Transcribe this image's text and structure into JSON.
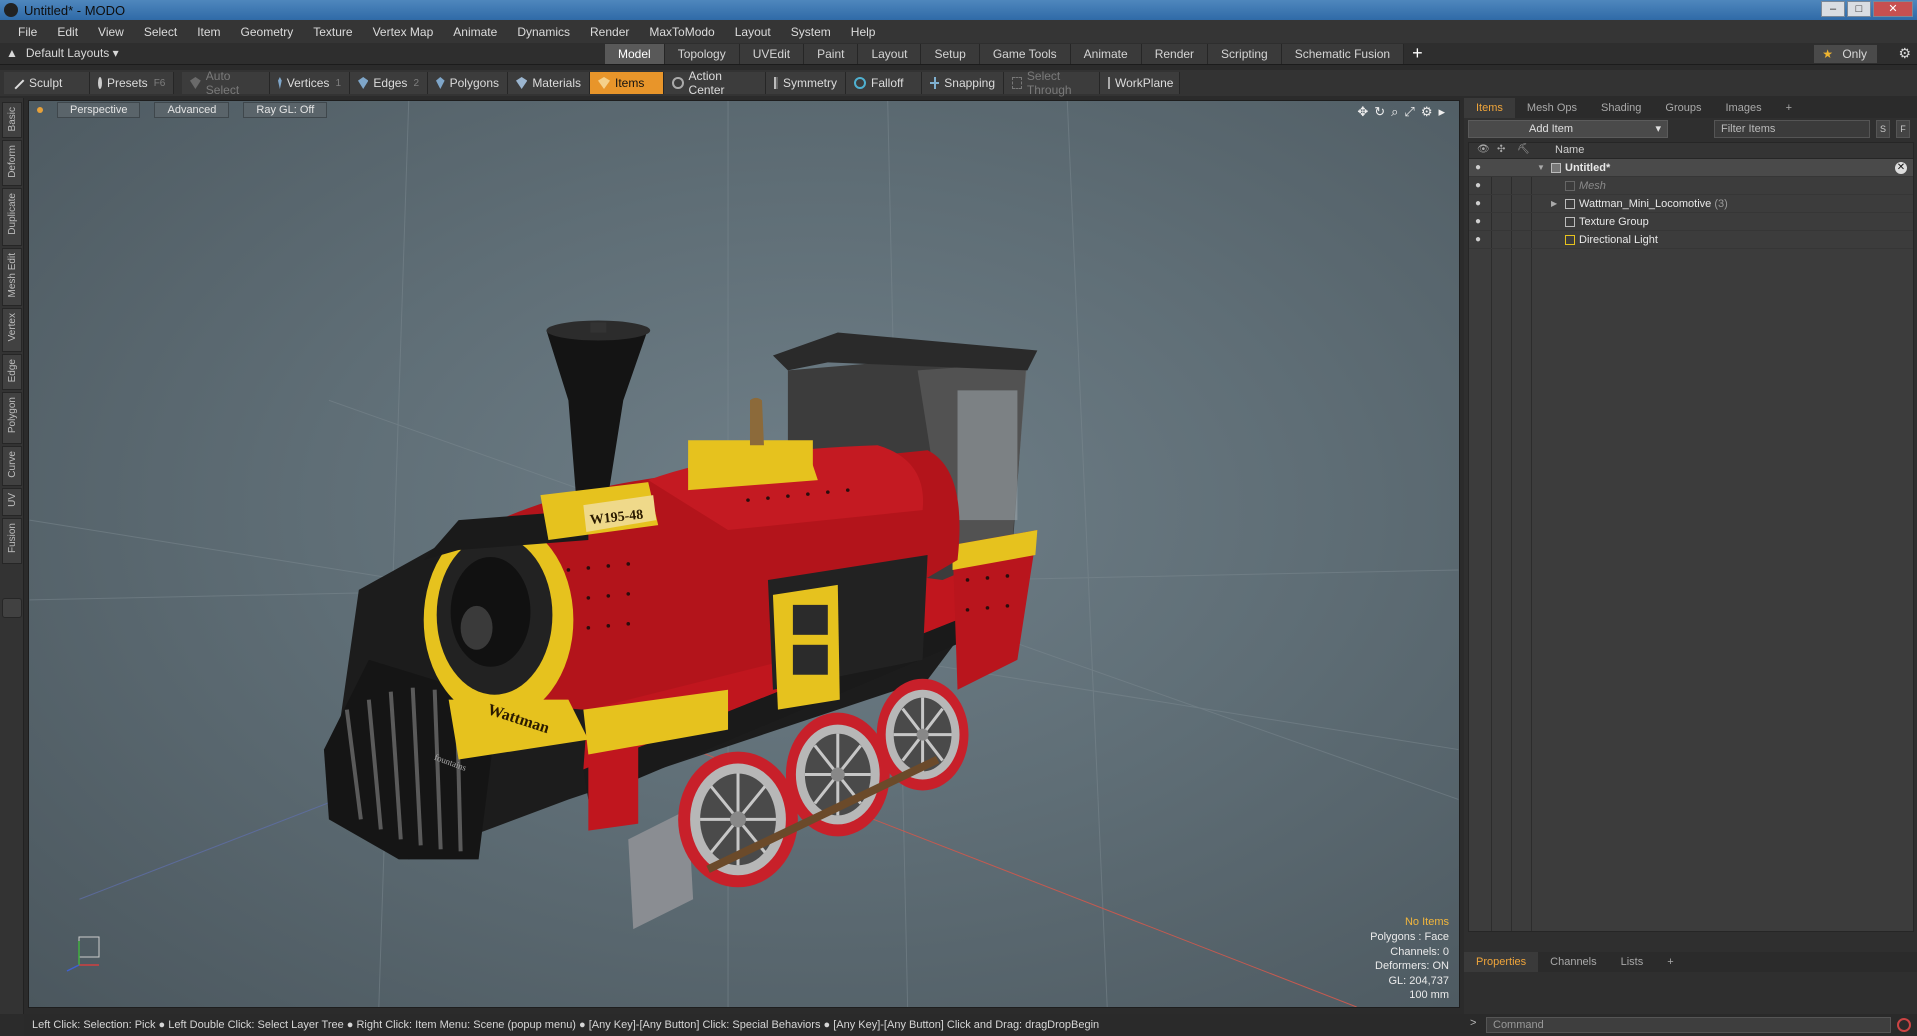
{
  "window": {
    "title": "Untitled* - MODO",
    "buttons": {
      "minimize": "–",
      "maximize": "□",
      "close": "✕"
    }
  },
  "menu": [
    "File",
    "Edit",
    "View",
    "Select",
    "Item",
    "Geometry",
    "Texture",
    "Vertex Map",
    "Animate",
    "Dynamics",
    "Render",
    "MaxToModo",
    "Layout",
    "System",
    "Help"
  ],
  "layoutbar": {
    "layouts_label": "Default Layouts ▾",
    "tabs": [
      "Model",
      "Topology",
      "UVEdit",
      "Paint",
      "Layout",
      "Setup",
      "Game Tools",
      "Animate",
      "Render",
      "Scripting",
      "Schematic Fusion"
    ],
    "active_tab": "Model",
    "add": "+",
    "only_label": "Only"
  },
  "toolbar": {
    "sculpt": "Sculpt",
    "presets": "Presets",
    "presets_key": "F6",
    "auto_select": "Auto Select",
    "vertices": "Vertices",
    "vertices_key": "1",
    "edges": "Edges",
    "edges_key": "2",
    "polygons": "Polygons",
    "materials": "Materials",
    "items": "Items",
    "action_center": "Action Center",
    "symmetry": "Symmetry",
    "falloff": "Falloff",
    "snapping": "Snapping",
    "select_through": "Select Through",
    "workplane": "WorkPlane"
  },
  "left_tabs": [
    "Basic",
    "Deform",
    "Duplicate",
    "Mesh Edit",
    "Vertex",
    "Edge",
    "Polygon",
    "Curve",
    "UV",
    "Fusion"
  ],
  "viewport": {
    "view": "Perspective",
    "shading": "Advanced",
    "raygl": "Ray GL: Off",
    "info": {
      "no_items": "No Items",
      "polygons": "Polygons : Face",
      "channels": "Channels: 0",
      "deformers": "Deformers: ON",
      "gl": "GL: 204,737",
      "scale": "100 mm"
    },
    "model_text": {
      "number_plate": "W195-48",
      "brand": "Wattman",
      "maker": "fountains"
    }
  },
  "items_panel": {
    "tabs": [
      "Items",
      "Mesh Ops",
      "Shading",
      "Groups",
      "Images",
      "+"
    ],
    "add_item": "Add Item",
    "filter_placeholder": "Filter Items",
    "s_btn": "S",
    "f_btn": "F",
    "column_name": "Name",
    "tree": [
      {
        "label": "Untitled*",
        "count": ""
      },
      {
        "label": "Mesh",
        "count": ""
      },
      {
        "label": "Wattman_Mini_Locomotive",
        "count": "(3)"
      },
      {
        "label": "Texture Group",
        "count": ""
      },
      {
        "label": "Directional Light",
        "count": ""
      }
    ]
  },
  "properties_panel": {
    "tabs": [
      "Properties",
      "Channels",
      "Lists",
      "+"
    ]
  },
  "status": "Left Click: Selection: Pick ● Left Double Click: Select Layer Tree ● Right Click: Item Menu: Scene (popup menu) ● [Any Key]-[Any Button] Click: Special Behaviors ● [Any Key]-[Any Button] Click and Drag: dragDropBegin",
  "command": {
    "prompt": ">",
    "placeholder": "Command"
  },
  "colors": {
    "accent": "#e8952a",
    "body_red": "#b3141b",
    "trim_yellow": "#e6c21e",
    "viewport_bg": "#5f6e76"
  }
}
